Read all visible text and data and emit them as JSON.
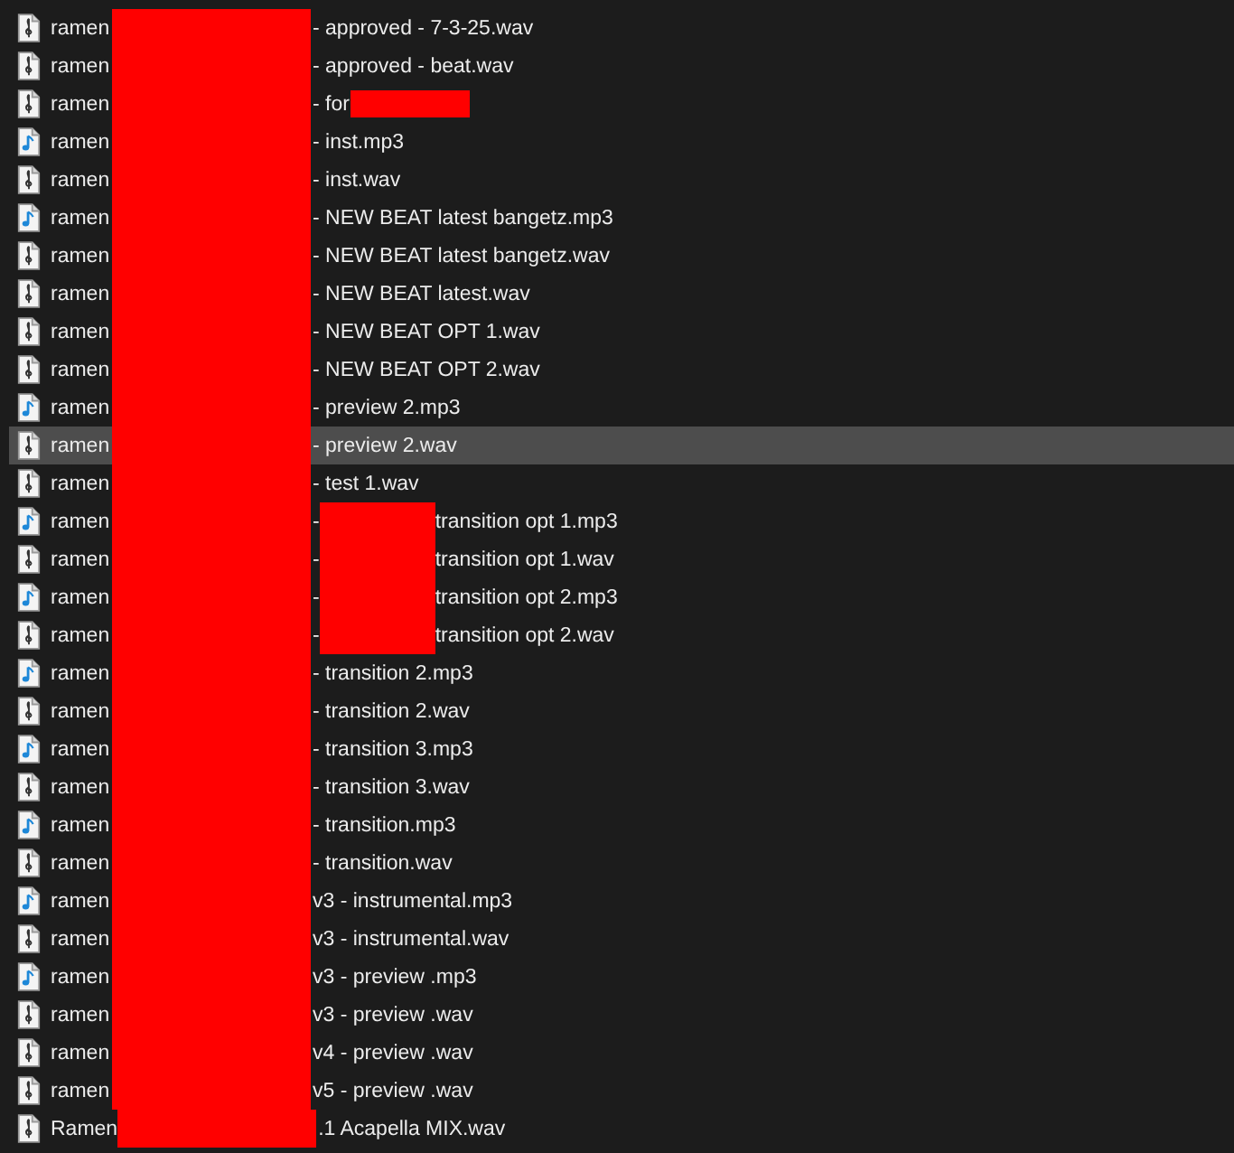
{
  "files": [
    {
      "kind": "audio",
      "selected": false,
      "segments": [
        {
          "kind": "text",
          "text": "ramen"
        },
        {
          "kind": "redaction"
        },
        {
          "kind": "text",
          "text": "- approved - 7-3-25.wav"
        }
      ]
    },
    {
      "kind": "audio",
      "selected": false,
      "segments": [
        {
          "kind": "text",
          "text": "ramen"
        },
        {
          "kind": "redaction"
        },
        {
          "kind": "text",
          "text": "- approved - beat.wav"
        }
      ]
    },
    {
      "kind": "audio",
      "selected": false,
      "segments": [
        {
          "kind": "text",
          "text": "ramen"
        },
        {
          "kind": "redaction"
        },
        {
          "kind": "text",
          "text": "- for"
        },
        {
          "kind": "redaction"
        }
      ]
    },
    {
      "kind": "music",
      "selected": false,
      "segments": [
        {
          "kind": "text",
          "text": "ramen"
        },
        {
          "kind": "redaction"
        },
        {
          "kind": "text",
          "text": "- inst.mp3"
        }
      ]
    },
    {
      "kind": "audio",
      "selected": false,
      "segments": [
        {
          "kind": "text",
          "text": "ramen"
        },
        {
          "kind": "redaction"
        },
        {
          "kind": "text",
          "text": "- inst.wav"
        }
      ]
    },
    {
      "kind": "music",
      "selected": false,
      "segments": [
        {
          "kind": "text",
          "text": "ramen"
        },
        {
          "kind": "redaction"
        },
        {
          "kind": "text",
          "text": "- NEW BEAT latest bangetz.mp3"
        }
      ]
    },
    {
      "kind": "audio",
      "selected": false,
      "segments": [
        {
          "kind": "text",
          "text": "ramen"
        },
        {
          "kind": "redaction"
        },
        {
          "kind": "text",
          "text": "- NEW BEAT latest bangetz.wav"
        }
      ]
    },
    {
      "kind": "audio",
      "selected": false,
      "segments": [
        {
          "kind": "text",
          "text": "ramen"
        },
        {
          "kind": "redaction"
        },
        {
          "kind": "text",
          "text": "- NEW BEAT latest.wav"
        }
      ]
    },
    {
      "kind": "audio",
      "selected": false,
      "segments": [
        {
          "kind": "text",
          "text": "ramen"
        },
        {
          "kind": "redaction"
        },
        {
          "kind": "text",
          "text": "- NEW BEAT OPT 1.wav"
        }
      ]
    },
    {
      "kind": "audio",
      "selected": false,
      "segments": [
        {
          "kind": "text",
          "text": "ramen"
        },
        {
          "kind": "redaction"
        },
        {
          "kind": "text",
          "text": "- NEW BEAT OPT 2.wav"
        }
      ]
    },
    {
      "kind": "music",
      "selected": false,
      "segments": [
        {
          "kind": "text",
          "text": "ramen"
        },
        {
          "kind": "redaction"
        },
        {
          "kind": "text",
          "text": "- preview 2.mp3"
        }
      ]
    },
    {
      "kind": "audio",
      "selected": true,
      "segments": [
        {
          "kind": "text",
          "text": "ramen"
        },
        {
          "kind": "redaction"
        },
        {
          "kind": "text",
          "text": "- preview 2.wav"
        }
      ]
    },
    {
      "kind": "audio",
      "selected": false,
      "segments": [
        {
          "kind": "text",
          "text": "ramen"
        },
        {
          "kind": "redaction"
        },
        {
          "kind": "text",
          "text": "- test 1.wav"
        }
      ]
    },
    {
      "kind": "music",
      "selected": false,
      "segments": [
        {
          "kind": "text",
          "text": "ramen"
        },
        {
          "kind": "redaction"
        },
        {
          "kind": "text",
          "text": "-"
        },
        {
          "kind": "redaction"
        },
        {
          "kind": "text",
          "text": "transition opt 1.mp3"
        }
      ]
    },
    {
      "kind": "audio",
      "selected": false,
      "segments": [
        {
          "kind": "text",
          "text": "ramen"
        },
        {
          "kind": "redaction"
        },
        {
          "kind": "text",
          "text": "-"
        },
        {
          "kind": "redaction"
        },
        {
          "kind": "text",
          "text": "transition opt 1.wav"
        }
      ]
    },
    {
      "kind": "music",
      "selected": false,
      "segments": [
        {
          "kind": "text",
          "text": "ramen"
        },
        {
          "kind": "redaction"
        },
        {
          "kind": "text",
          "text": "-"
        },
        {
          "kind": "redaction"
        },
        {
          "kind": "text",
          "text": "transition opt 2.mp3"
        }
      ]
    },
    {
      "kind": "audio",
      "selected": false,
      "segments": [
        {
          "kind": "text",
          "text": "ramen"
        },
        {
          "kind": "redaction"
        },
        {
          "kind": "text",
          "text": "-"
        },
        {
          "kind": "redaction"
        },
        {
          "kind": "text",
          "text": "transition opt 2.wav"
        }
      ]
    },
    {
      "kind": "music",
      "selected": false,
      "segments": [
        {
          "kind": "text",
          "text": "ramen"
        },
        {
          "kind": "redaction"
        },
        {
          "kind": "text",
          "text": "- transition 2.mp3"
        }
      ]
    },
    {
      "kind": "audio",
      "selected": false,
      "segments": [
        {
          "kind": "text",
          "text": "ramen"
        },
        {
          "kind": "redaction"
        },
        {
          "kind": "text",
          "text": "- transition 2.wav"
        }
      ]
    },
    {
      "kind": "music",
      "selected": false,
      "segments": [
        {
          "kind": "text",
          "text": "ramen"
        },
        {
          "kind": "redaction"
        },
        {
          "kind": "text",
          "text": "- transition 3.mp3"
        }
      ]
    },
    {
      "kind": "audio",
      "selected": false,
      "segments": [
        {
          "kind": "text",
          "text": "ramen"
        },
        {
          "kind": "redaction"
        },
        {
          "kind": "text",
          "text": "- transition 3.wav"
        }
      ]
    },
    {
      "kind": "music",
      "selected": false,
      "segments": [
        {
          "kind": "text",
          "text": "ramen"
        },
        {
          "kind": "redaction"
        },
        {
          "kind": "text",
          "text": "- transition.mp3"
        }
      ]
    },
    {
      "kind": "audio",
      "selected": false,
      "segments": [
        {
          "kind": "text",
          "text": "ramen"
        },
        {
          "kind": "redaction"
        },
        {
          "kind": "text",
          "text": "- transition.wav"
        }
      ]
    },
    {
      "kind": "music",
      "selected": false,
      "segments": [
        {
          "kind": "text",
          "text": "ramen"
        },
        {
          "kind": "redaction"
        },
        {
          "kind": "text",
          "text": "v3 - instrumental.mp3"
        }
      ]
    },
    {
      "kind": "audio",
      "selected": false,
      "segments": [
        {
          "kind": "text",
          "text": "ramen"
        },
        {
          "kind": "redaction"
        },
        {
          "kind": "text",
          "text": "v3 - instrumental.wav"
        }
      ]
    },
    {
      "kind": "music",
      "selected": false,
      "segments": [
        {
          "kind": "text",
          "text": "ramen"
        },
        {
          "kind": "redaction"
        },
        {
          "kind": "text",
          "text": "v3 - preview .mp3"
        }
      ]
    },
    {
      "kind": "audio",
      "selected": false,
      "segments": [
        {
          "kind": "text",
          "text": "ramen"
        },
        {
          "kind": "redaction"
        },
        {
          "kind": "text",
          "text": "v3 - preview .wav"
        }
      ]
    },
    {
      "kind": "audio",
      "selected": false,
      "segments": [
        {
          "kind": "text",
          "text": "ramen"
        },
        {
          "kind": "redaction"
        },
        {
          "kind": "text",
          "text": "v4 - preview .wav"
        }
      ]
    },
    {
      "kind": "audio",
      "selected": false,
      "segments": [
        {
          "kind": "text",
          "text": "ramen"
        },
        {
          "kind": "redaction"
        },
        {
          "kind": "text",
          "text": "v5 - preview .wav"
        }
      ]
    },
    {
      "kind": "audio",
      "selected": false,
      "segments": [
        {
          "kind": "text",
          "text": "Ramen"
        },
        {
          "kind": "redaction"
        },
        {
          "kind": "text",
          "text": ".1 Acapella MIX.wav"
        }
      ]
    }
  ]
}
